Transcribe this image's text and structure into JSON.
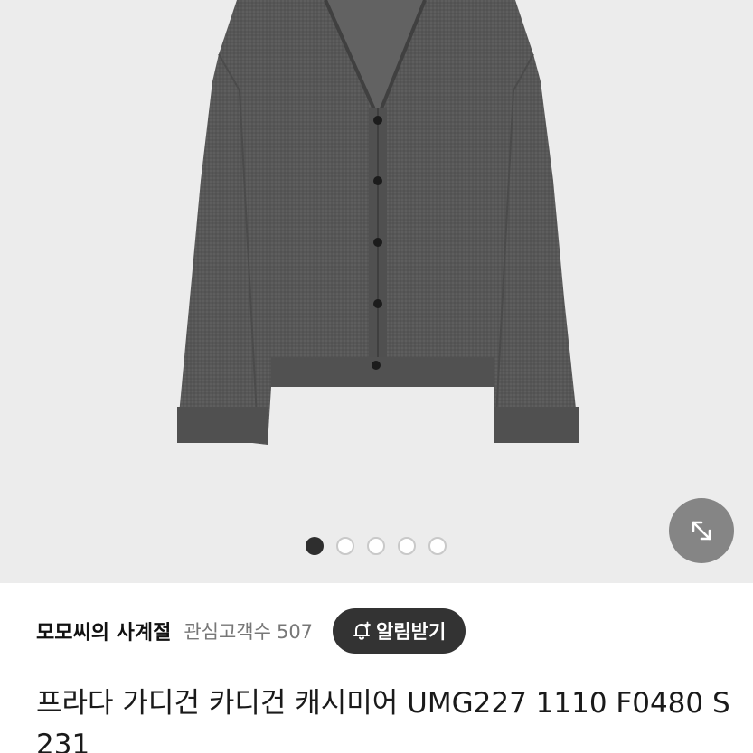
{
  "product_image": {
    "alt": "",
    "background_color": "#ececec",
    "garment_color": "#555555"
  },
  "carousel": {
    "total": 5,
    "active_index": 0,
    "dots": [
      "dot-1",
      "dot-2",
      "dot-3",
      "dot-4",
      "dot-5"
    ]
  },
  "expand_button": {
    "icon": "expand-arrows-icon"
  },
  "shop": {
    "name": "모모씨의 사계절",
    "follower_label": "관심고객수",
    "follower_count": "507"
  },
  "notify_button": {
    "icon": "bell-plus-icon",
    "label": "알림받기"
  },
  "product": {
    "title": "프라다 가디건 카디건 캐시미어 UMG227 1110 F0480 S 231"
  },
  "colors": {
    "notify_bg": "#333333",
    "active_dot": "#2e2e2e",
    "text_primary": "#111111",
    "text_secondary": "#777777"
  }
}
